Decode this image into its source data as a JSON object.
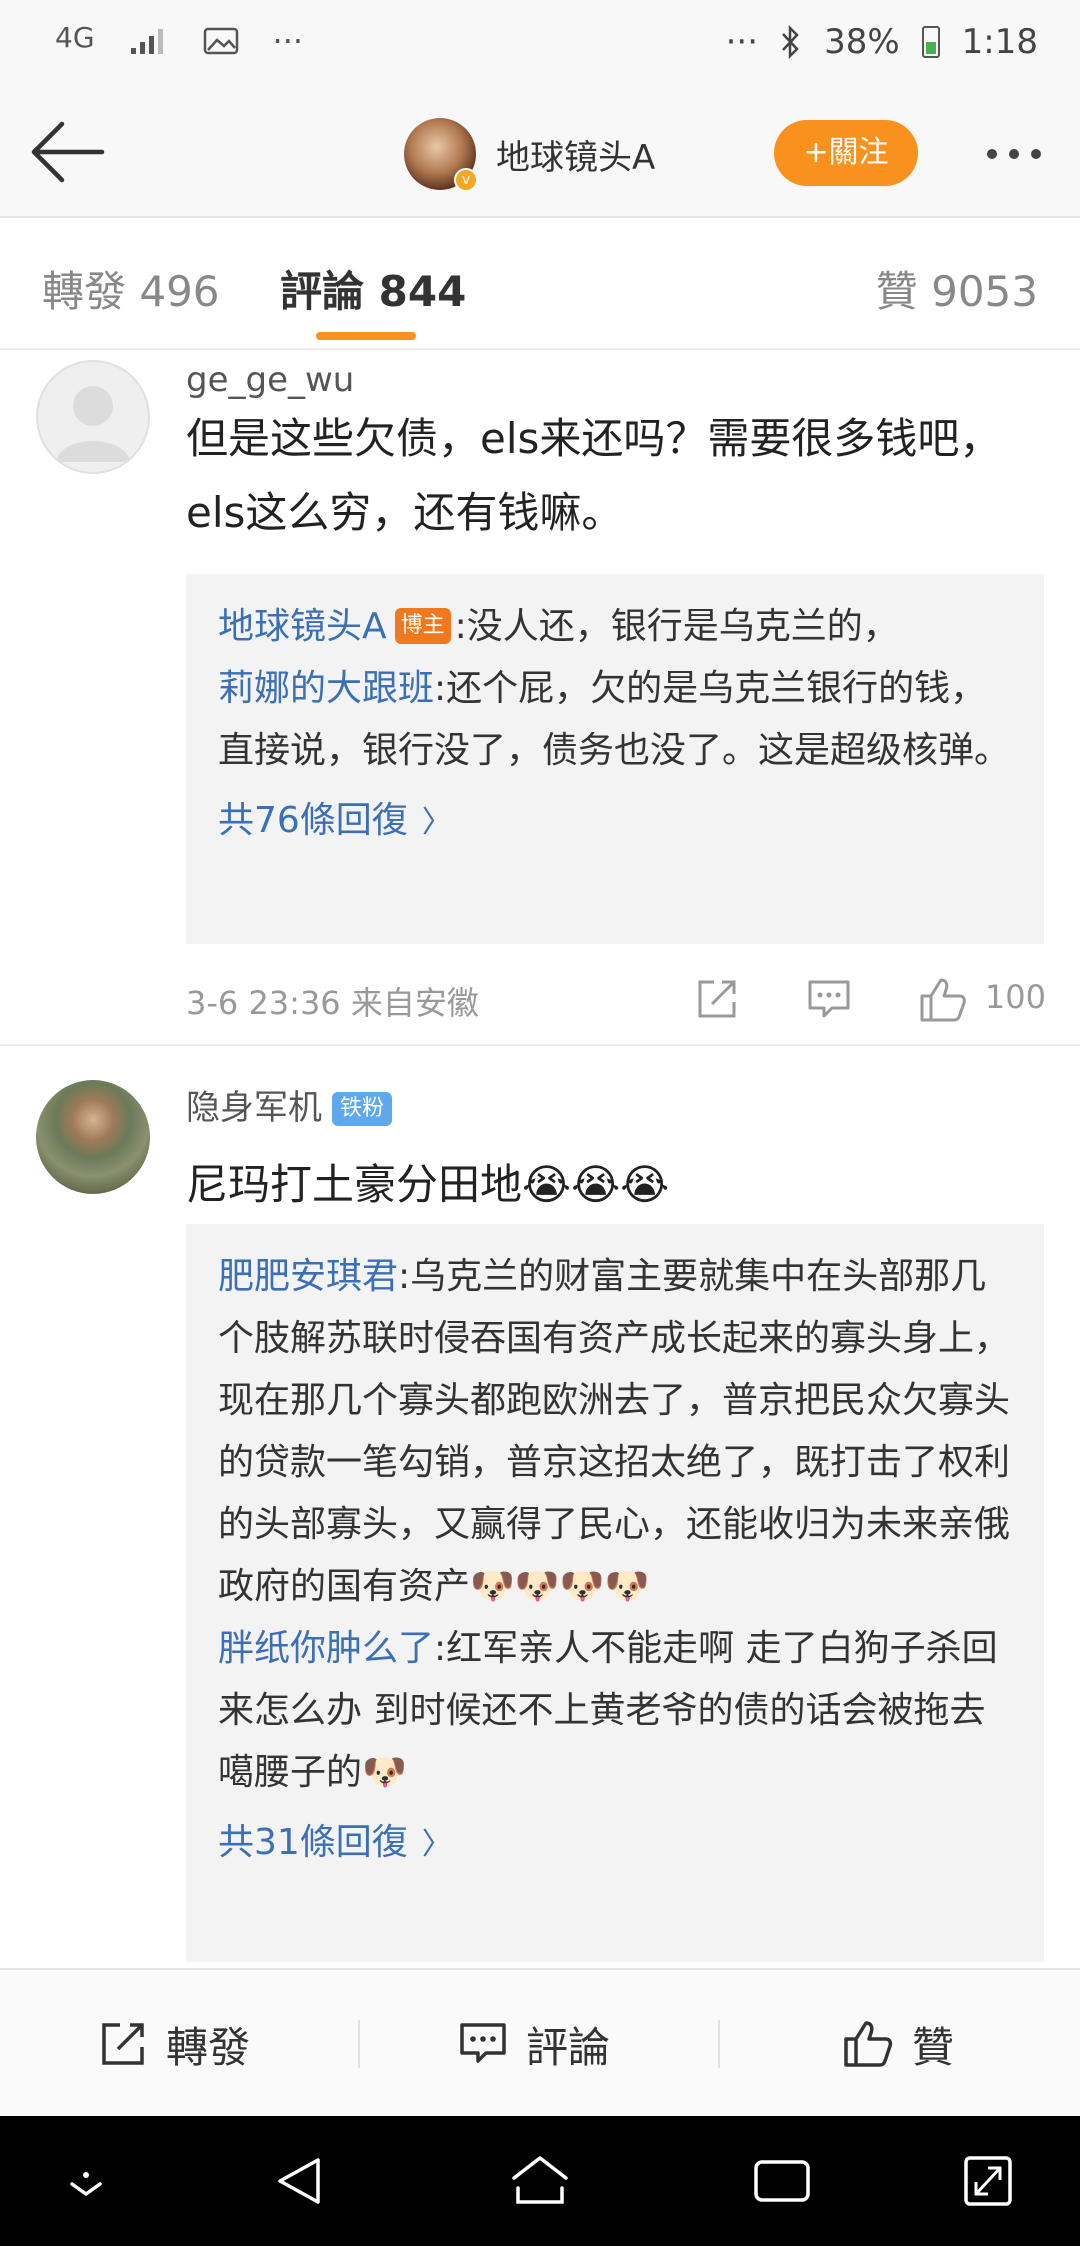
{
  "status_bar": {
    "network": "4G",
    "dots_left": "···",
    "dots_right": "···",
    "battery": "38%",
    "time": "1:18"
  },
  "header": {
    "author_name": "地球镜头A",
    "follow_label": "+關注"
  },
  "tabs": {
    "repost": "轉發 496",
    "comments": "評論 844",
    "likes": "贊 9053"
  },
  "comments": [
    {
      "username": "ge_ge_wu",
      "text": "但是这些欠债，els来还吗？需要很多钱吧，els这么穷，还有钱嘛。",
      "replies": [
        {
          "name": "地球镜头A",
          "badge": "博主",
          "text": ":没人还，银行是乌克兰的，"
        },
        {
          "name": "莉娜的大跟班",
          "text": ":还个屁，欠的是乌克兰银行的钱，直接说，银行没了，债务也没了。这是超级核弹。"
        }
      ],
      "more_replies": "共76條回復",
      "time": "3-6 23:36 来自安徽",
      "likes": "100"
    },
    {
      "username": "隐身军机",
      "fan_badge": "铁粉",
      "text": "尼玛打土豪分田地😭😭😭",
      "replies": [
        {
          "name": "肥肥安琪君",
          "text": ":乌克兰的财富主要就集中在头部那几个肢解苏联时侵吞国有资产成长起来的寡头身上，现在那几个寡头都跑欧洲去了，普京把民众欠寡头的贷款一笔勾销，普京这招太绝了，既打击了权利的头部寡头，又赢得了民心，还能收归为未来亲俄政府的国有资产🐶🐶🐶🐶"
        },
        {
          "name": "胖纸你肿么了",
          "text": ":红军亲人不能走啊 走了白狗子杀回来怎么办 到时候还不上黄老爷的债的话会被拖去噶腰子的🐶"
        }
      ],
      "more_replies": "共31條回復"
    }
  ],
  "action_bar": {
    "repost": "轉發",
    "comment": "評論",
    "like": "贊"
  },
  "colors": {
    "accent": "#f8911e",
    "link": "#3b6fb6",
    "blogger_badge": "#f0791f",
    "fan_badge": "#5fa8ec"
  }
}
